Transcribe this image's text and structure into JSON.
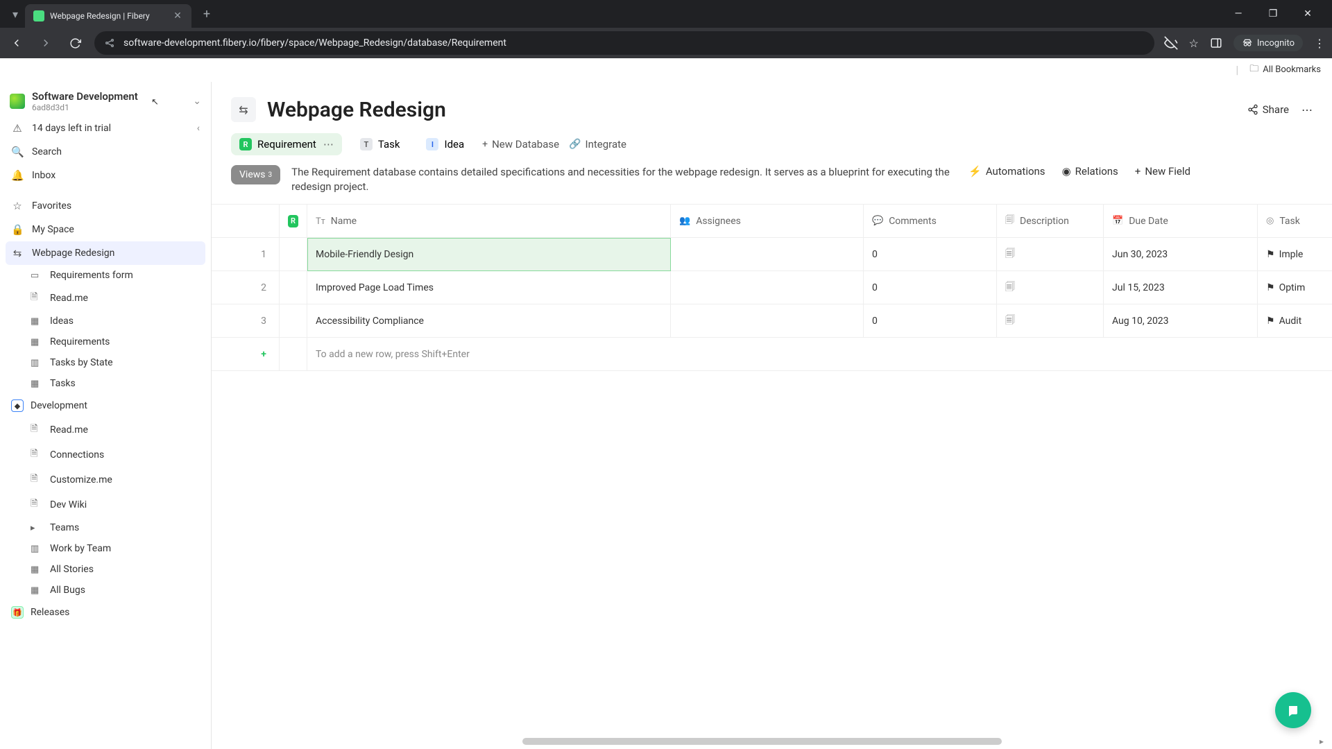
{
  "browser": {
    "tab_title": "Webpage Redesign | Fibery",
    "url": "software-development.fibery.io/fibery/space/Webpage_Redesign/database/Requirement",
    "incognito_label": "Incognito",
    "all_bookmarks": "All Bookmarks"
  },
  "workspace": {
    "name": "Software Development",
    "subtitle": "6ad8d3d1",
    "trial_label": "14 days left in trial"
  },
  "sidebar": {
    "search": "Search",
    "inbox": "Inbox",
    "favorites": "Favorites",
    "myspace": "My Space",
    "spaces": [
      {
        "name": "Webpage Redesign",
        "items": [
          "Requirements form",
          "Read.me",
          "Ideas",
          "Requirements",
          "Tasks by State",
          "Tasks"
        ]
      },
      {
        "name": "Development",
        "items": [
          "Read.me",
          "Connections",
          "Customize.me",
          "Dev Wiki",
          "Teams",
          "Work by Team",
          "All Stories",
          "All Bugs"
        ]
      }
    ],
    "releases": "Releases"
  },
  "page": {
    "title": "Webpage Redesign",
    "share": "Share"
  },
  "db_tabs": {
    "requirement": "Requirement",
    "task": "Task",
    "idea": "Idea",
    "new_database": "New Database",
    "integrate": "Integrate"
  },
  "views": {
    "label": "Views",
    "count": "3"
  },
  "description": "The Requirement database contains detailed specifications and necessities for the webpage redesign. It serves as a blueprint for executing the redesign project.",
  "toolbar": {
    "automations": "Automations",
    "relations": "Relations",
    "new_field": "New Field"
  },
  "columns": {
    "name": "Name",
    "assignees": "Assignees",
    "comments": "Comments",
    "description": "Description",
    "due_date": "Due Date",
    "task": "Task"
  },
  "rows": [
    {
      "num": "1",
      "name": "Mobile-Friendly Design",
      "assignees": "",
      "comments": "0",
      "due": "Jun 30, 2023",
      "task": "Imple"
    },
    {
      "num": "2",
      "name": "Improved Page Load Times",
      "assignees": "",
      "comments": "0",
      "due": "Jul 15, 2023",
      "task": "Optim"
    },
    {
      "num": "3",
      "name": "Accessibility Compliance",
      "assignees": "",
      "comments": "0",
      "due": "Aug 10, 2023",
      "task": "Audit"
    }
  ],
  "add_row_hint": "To add a new row, press Shift+Enter",
  "badges": {
    "r": "R",
    "t": "T",
    "i": "I"
  }
}
